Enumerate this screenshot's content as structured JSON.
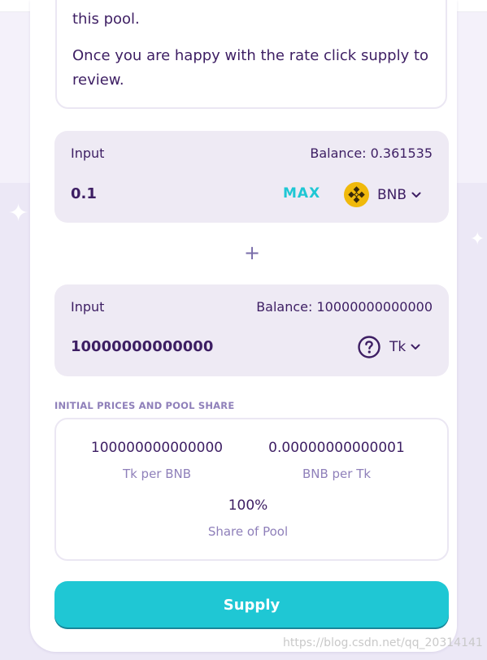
{
  "info": {
    "line1": "this pool.",
    "line2": "Once you are happy with the rate click supply to",
    "line3": "review."
  },
  "input_a": {
    "label": "Input",
    "balance": "Balance: 0.361535",
    "amount": "0.1",
    "max_label": "MAX",
    "token": "BNB",
    "token_icon": "bnb-logo-icon"
  },
  "plus_symbol": "+",
  "input_b": {
    "label": "Input",
    "balance": "Balance: 10000000000000",
    "amount": "10000000000000",
    "token": "Tk",
    "token_icon": "question-circle-icon"
  },
  "prices": {
    "title": "INITIAL PRICES AND POOL SHARE",
    "tk_per_bnb_value": "100000000000000",
    "tk_per_bnb_label": "Tk per BNB",
    "bnb_per_tk_value": "0.00000000000001",
    "bnb_per_tk_label": "BNB per Tk",
    "share_value": "100%",
    "share_label": "Share of Pool"
  },
  "supply_label": "Supply",
  "watermark": "https://blog.csdn.net/qq_20314141",
  "colors": {
    "text_primary": "#3d1e63",
    "text_secondary": "#8f80ba",
    "accent": "#1fc7d4",
    "panel_bg": "#eeeaf4",
    "bnb_yellow": "#f0b90b"
  }
}
